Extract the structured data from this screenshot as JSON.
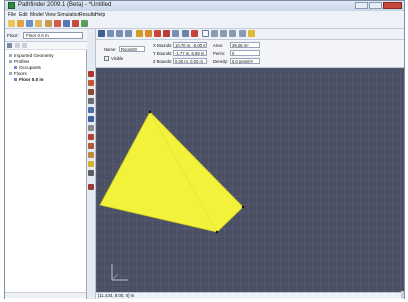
{
  "window": {
    "title": "Pathfinder 2009.1 (Beta) - *Untitled"
  },
  "menu": [
    "File",
    "Edit",
    "Model",
    "View",
    "Simulation",
    "Results",
    "Help"
  ],
  "floor_selector": {
    "label": "Floor:",
    "value": "Floor 0.0 m"
  },
  "tree": [
    {
      "label": "Imported Geometry",
      "indent": 0,
      "bold": false
    },
    {
      "label": "Profiles",
      "indent": 0,
      "bold": false
    },
    {
      "label": "Occupants",
      "indent": 1,
      "bold": false
    },
    {
      "label": "Floors",
      "indent": 0,
      "bold": false
    },
    {
      "label": "Floor 0.0 m",
      "indent": 1,
      "bold": true
    }
  ],
  "properties": {
    "name_label": "Name:",
    "name_value": "Room00",
    "visible_label": "Visible",
    "visible_checked": true,
    "xbounds_label": "X Bounds:",
    "xbounds_value": "10.70 m, -5.00 m",
    "ybounds_label": "Y Bounds:",
    "ybounds_value": "-1.77 m, 6.99 m",
    "zbounds_label": "Z Bounds:",
    "zbounds_value": "0.00 m, 0.00 m",
    "area_label": "Area:",
    "area_value": "39.26 m²",
    "perim_label": "Perim:",
    "perim_value": "0",
    "density_label": "Density:",
    "density_value": "0.0 pers/m²"
  },
  "status": {
    "coords": "[11.434, 8.00, 0] m"
  },
  "colors": {
    "canvas_bg": "#4c5064",
    "grid": "#6c7084",
    "room_fill": "#f2f23a",
    "room_edge": "#c8c82a"
  }
}
